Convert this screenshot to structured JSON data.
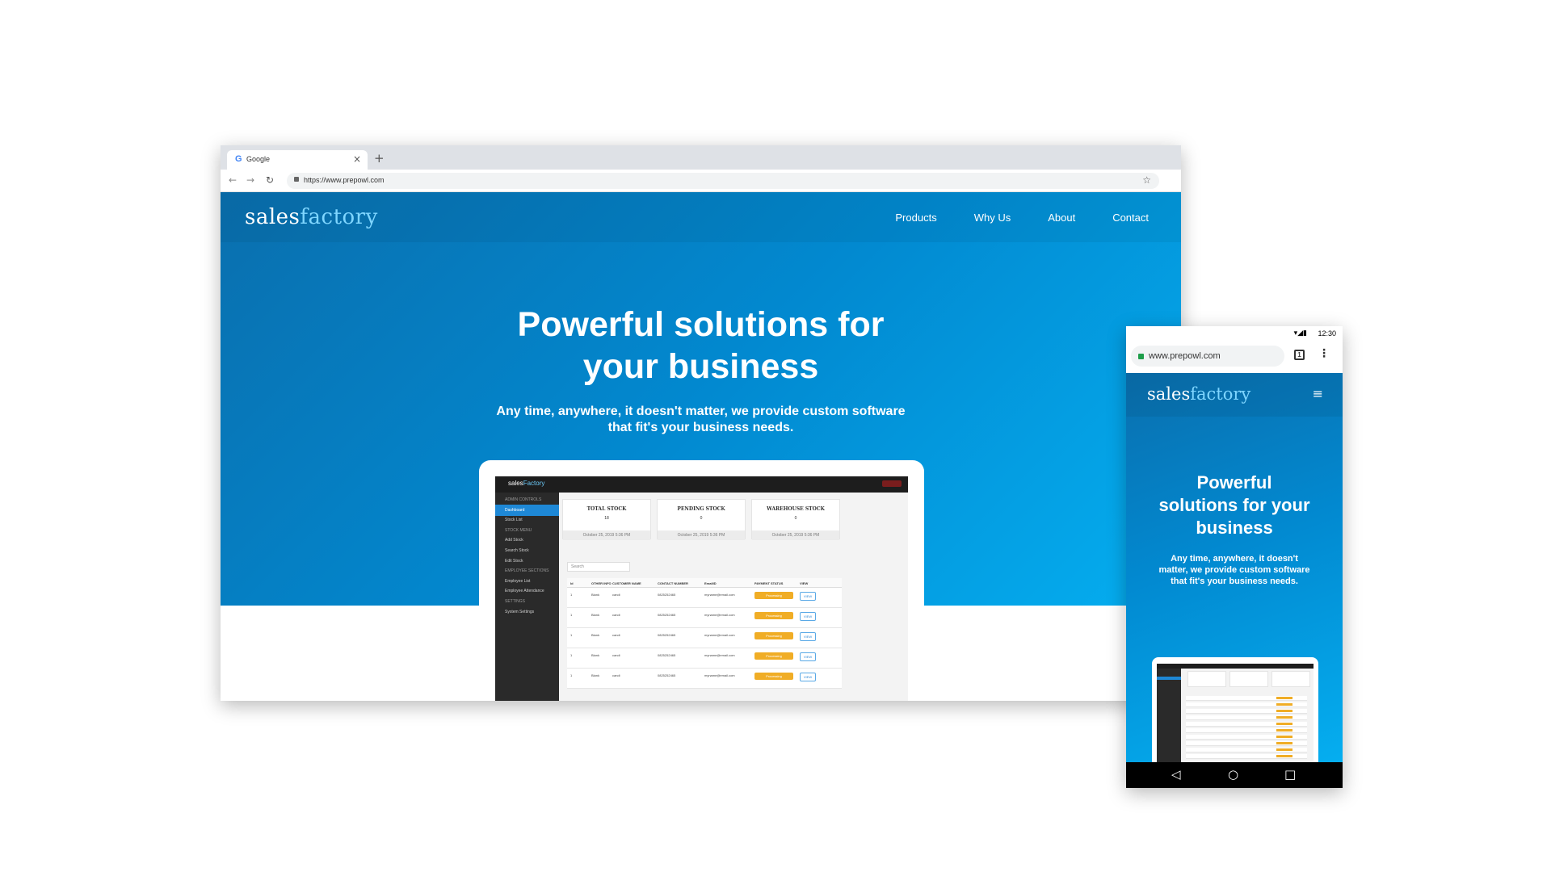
{
  "desktop": {
    "tab_title": "Google",
    "tab_icon": "G",
    "tab_close": "×",
    "new_tab": "+",
    "url": "https://www.prepowl.com",
    "nav": {
      "back": "←",
      "forward": "→",
      "reload": "↻",
      "bookmark": "☆"
    }
  },
  "site": {
    "logo_light": "sales",
    "logo_brand": "factory",
    "menu": [
      "Products",
      "Why Us",
      "About",
      "Contact"
    ],
    "hero_title_line1": "Powerful solutions for",
    "hero_title_line2": "your business",
    "hero_sub_line1": "Any time, anywhere, it doesn't matter, we provide custom software",
    "hero_sub_line2": "that fit's your business needs."
  },
  "app_preview": {
    "logo_light": "sales",
    "logo_brand": "Factory",
    "sidebar": [
      {
        "label": "ADMIN CONTROLS",
        "kind": "section"
      },
      {
        "label": "Dashboard",
        "kind": "active"
      },
      {
        "label": "Stock List",
        "kind": "item"
      },
      {
        "label": "STOCK MENU",
        "kind": "section"
      },
      {
        "label": "Add Stock",
        "kind": "item"
      },
      {
        "label": "Search Stock",
        "kind": "item"
      },
      {
        "label": "Edit Stock",
        "kind": "item"
      },
      {
        "label": "EMPLOYEE SECTIONS",
        "kind": "section"
      },
      {
        "label": "Employee List",
        "kind": "item"
      },
      {
        "label": "Employee Attendance",
        "kind": "item"
      },
      {
        "label": "SETTINGS",
        "kind": "section"
      },
      {
        "label": "System Settings",
        "kind": "item"
      }
    ],
    "stats": [
      {
        "title": "TOTAL STOCK",
        "value": "18",
        "date": "October 25, 2019 5:36 PM"
      },
      {
        "title": "PENDING STOCK",
        "value": "0",
        "date": "October 25, 2019 5:36 PM"
      },
      {
        "title": "WAREHOUSE STOCK",
        "value": "0",
        "date": "October 25, 2019 5:36 PM"
      }
    ],
    "search_placeholder": "Search",
    "columns": [
      "Id",
      "OTHER INFO",
      "CUSTOMER NAME",
      "CONTACT NUMBER",
      "EmailID",
      "PAYMENT STATUS",
      "VIEW"
    ],
    "rows": [
      {
        "id": "1",
        "info": "Blank",
        "name": "candi",
        "phone": "0825252465",
        "email": "myname@email.com",
        "status": "Processing",
        "action": "VIEW"
      },
      {
        "id": "1",
        "info": "Blank",
        "name": "candi",
        "phone": "0825252465",
        "email": "myname@email.com",
        "status": "Processing",
        "action": "VIEW"
      },
      {
        "id": "1",
        "info": "Blank",
        "name": "candi",
        "phone": "0825252465",
        "email": "myname@email.com",
        "status": "Processing",
        "action": "VIEW"
      },
      {
        "id": "1",
        "info": "Blank",
        "name": "candi",
        "phone": "0825252465",
        "email": "myname@email.com",
        "status": "Processing",
        "action": "VIEW"
      },
      {
        "id": "1",
        "info": "Blank",
        "name": "candi",
        "phone": "0825252465",
        "email": "myname@email.com",
        "status": "Processing",
        "action": "VIEW"
      }
    ]
  },
  "mobile": {
    "status_icons": "▾◢▮",
    "time": "12:30",
    "url": "www.prepowl.com",
    "tab_count": "1",
    "kebab": "⋮",
    "burger": "≡",
    "hero_title": "Powerful solutions for your business",
    "hero_sub": "Any time, anywhere, it doesn't matter, we provide custom software that fit's your business needs.",
    "nav_back": "◁",
    "nav_home": "○",
    "nav_recent": "□"
  },
  "colors": {
    "brand_blue": "#0289d0",
    "accent_light": "#7fd6ff",
    "status_orange": "#f0ad26",
    "sidebar_dark": "#2a2a2a"
  }
}
